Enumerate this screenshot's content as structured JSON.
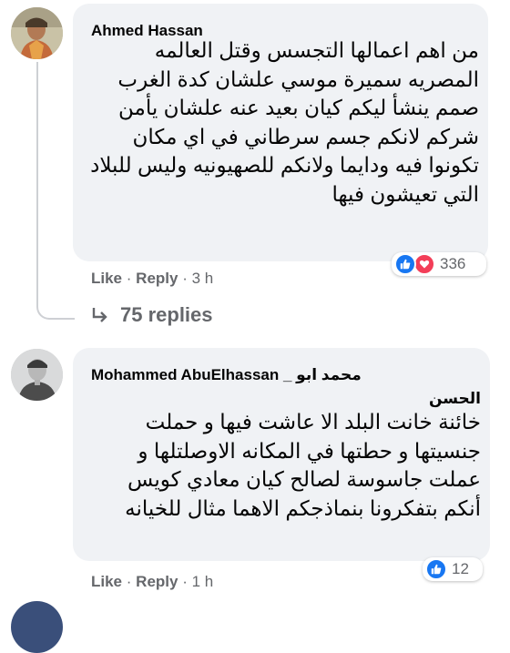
{
  "comments": [
    {
      "author": "Ahmed Hassan",
      "text": "من اهم اعمالها التجسس وقتل العالمه المصريه سميرة موسي علشان كدة الغرب صمم ينشأ ليكم كيان بعيد عنه علشان يأمن شركم لانكم جسم سرطاني في اي مكان تكونوا فيه ودايما ولانكم للصهيونيه وليس للبلاد التي تعيشون فيها",
      "like_label": "Like",
      "reply_label": "Reply",
      "time": "3 h",
      "reaction_count": "336",
      "reactions": [
        "like-icon",
        "love-icon"
      ],
      "replies_label": "75 replies"
    },
    {
      "author": "Mohammed AbuElhassan _ محمد ابو الحسن",
      "author_line1": "Mohammed AbuElhassan _ محمد ابو",
      "author_line2": "الحسن",
      "text": "خائنة خانت البلد الا عاشت فيها و حملت جنسيتها و حطتها في المكانه الاوصلتلها و عملت جاسوسة لصالح كيان معادي كويس أنكم بتفكرونا بنماذجكم الاهما مثال للخيانه",
      "like_label": "Like",
      "reply_label": "Reply",
      "time": "1 h",
      "reaction_count": "12",
      "reactions": [
        "like-icon"
      ]
    }
  ],
  "separator": "·",
  "colors": {
    "bubble": "#f0f2f5",
    "meta_text": "#65676b",
    "like_blue": "#1877f2",
    "love_red": "#f33e58"
  }
}
